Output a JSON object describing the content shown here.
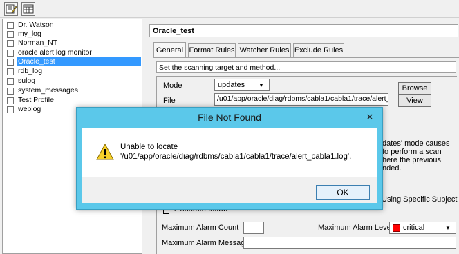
{
  "tree": {
    "items": [
      {
        "label": "Dr. Watson",
        "selected": false
      },
      {
        "label": "my_log",
        "selected": false
      },
      {
        "label": "Norman_NT",
        "selected": false
      },
      {
        "label": "oracle alert log monitor",
        "selected": false
      },
      {
        "label": "Oracle_test",
        "selected": true
      },
      {
        "label": "rdb_log",
        "selected": false
      },
      {
        "label": "sulog",
        "selected": false
      },
      {
        "label": "system_messages",
        "selected": false
      },
      {
        "label": "Test Profile",
        "selected": false
      },
      {
        "label": "weblog",
        "selected": false
      }
    ]
  },
  "panel": {
    "title": "Oracle_test",
    "tabs": [
      "General",
      "Format Rules",
      "Watcher Rules",
      "Exclude Rules"
    ],
    "active_tab": "General",
    "description": "Set the scanning target and method...",
    "mode_label": "Mode",
    "mode_value": "updates",
    "file_label": "File",
    "file_value": "/u01/app/oracle/diag/rdbms/cabla1/cabla1/trace/alert_c",
    "browse_label": "Browse",
    "view_label": "View",
    "hint_lines": [
      "dates' mode causes",
      "to perform a scan",
      "here the previous",
      "nded."
    ],
    "subject_label": "Using Specific Subject",
    "generate_alarm_label": "Generate Alarm",
    "max_alarm_count_label": "Maximum Alarm Count",
    "max_alarm_level_label": "Maximum Alarm Level",
    "max_alarm_level_value": "critical",
    "max_alarm_level_color": "#ff0000",
    "max_alarm_message_label": "Maximum Alarm Message"
  },
  "dialog": {
    "title": "File Not Found",
    "close_glyph": "✕",
    "line1": "Unable to locate",
    "line2": "'/u01/app/oracle/diag/rdbms/cabla1/cabla1/trace/alert_cabla1.log'.",
    "ok_label": "OK"
  }
}
